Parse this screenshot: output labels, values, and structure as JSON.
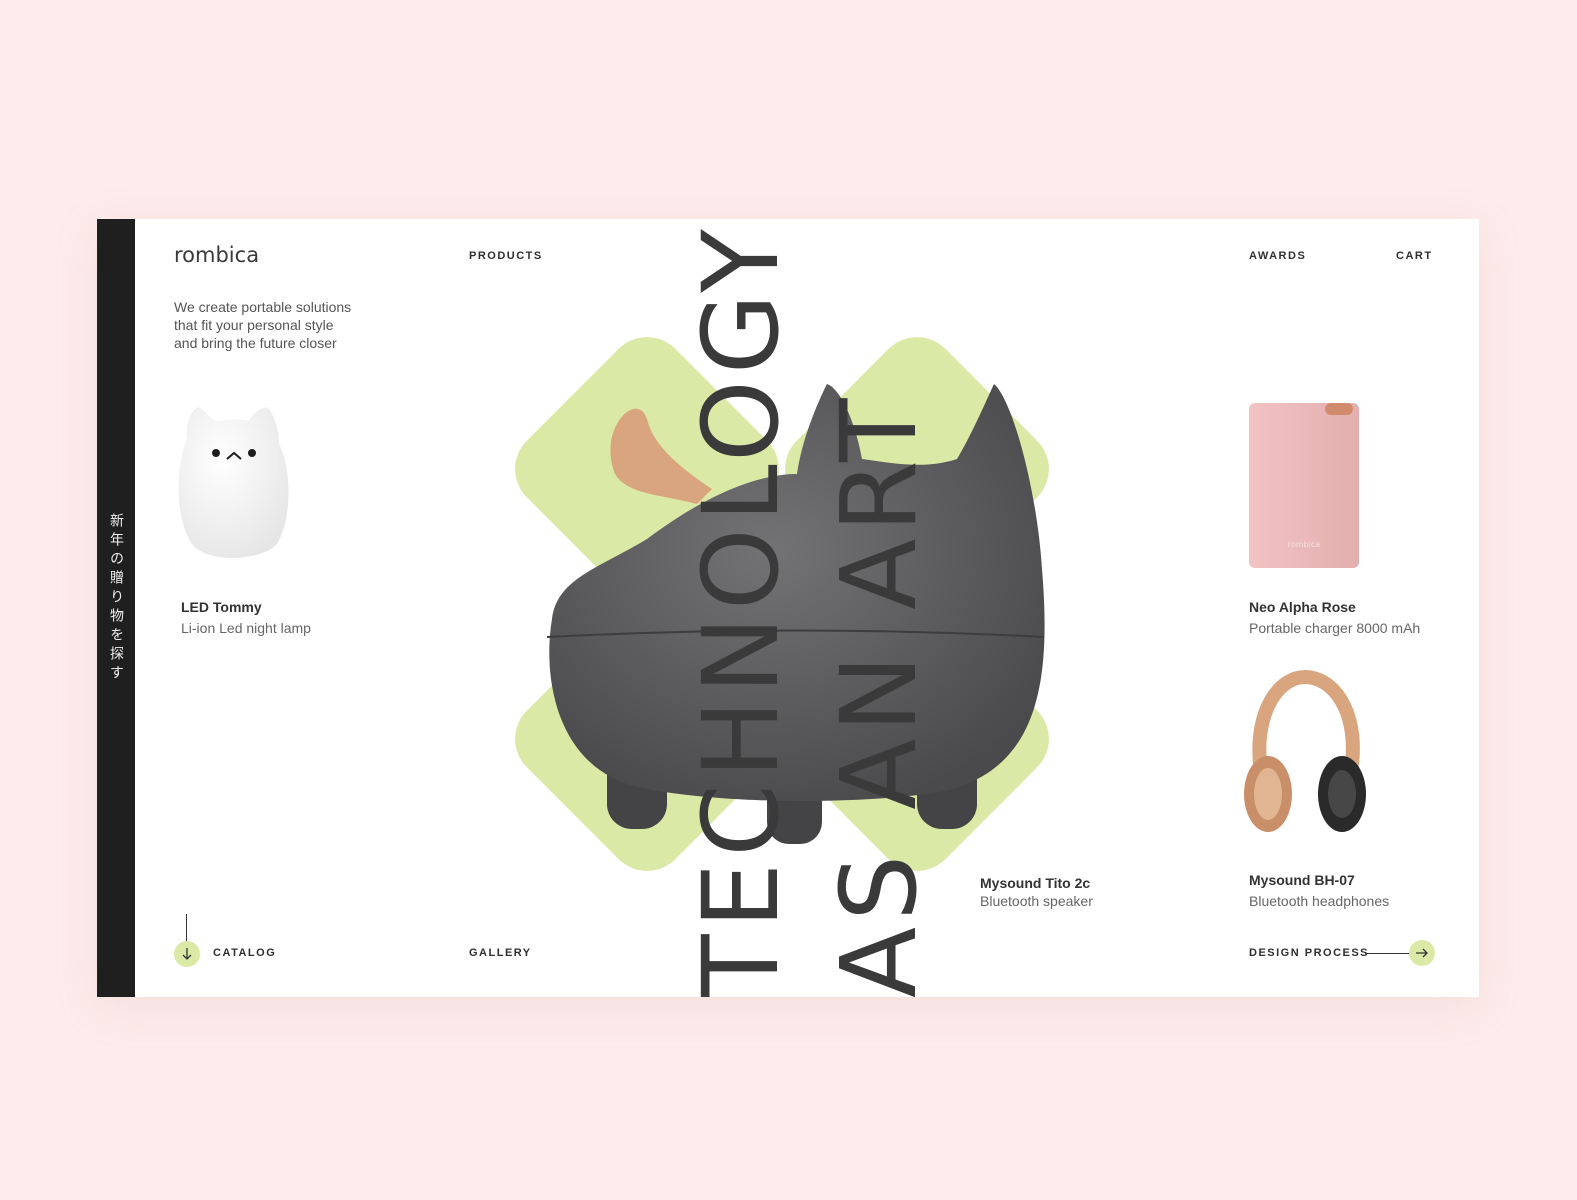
{
  "sidebar": {
    "japanese_text": "新年の贈り物を探す"
  },
  "brand": {
    "logo": "rombica"
  },
  "nav": {
    "products": "PRODUCTS",
    "awards": "AWARDS",
    "cart": "CART",
    "catalog": "CATALOG",
    "gallery": "GALLERY",
    "design_process": "DESIGN PROCESS"
  },
  "hero": {
    "tagline_line1": "We create portable solutions",
    "tagline_line2": "that fit your personal style",
    "tagline_line3": "and bring the future closer",
    "headline_word1": "TECHNOLOGY",
    "headline_word2": "AS AN ART"
  },
  "products": [
    {
      "name": "LED Tommy",
      "description": "Li-ion Led night lamp"
    },
    {
      "name": "Neo Alpha Rose",
      "description": "Portable charger 8000 mAh"
    },
    {
      "name": "Mysound Tito 2c",
      "description": "Bluetooth speaker"
    },
    {
      "name": "Mysound BH-07",
      "description": "Bluetooth headphones"
    }
  ],
  "product_logo_text": "rombica",
  "colors": {
    "background": "#fdeceb",
    "accent_green": "#dbe9a6",
    "sidebar": "#1f1f1f",
    "speaker": "#5f5e60",
    "charger": "#e9b7b7",
    "headphones": "#d9a57f"
  },
  "icons": {
    "catalog": "arrow-down-icon",
    "design_process": "arrow-right-icon"
  }
}
